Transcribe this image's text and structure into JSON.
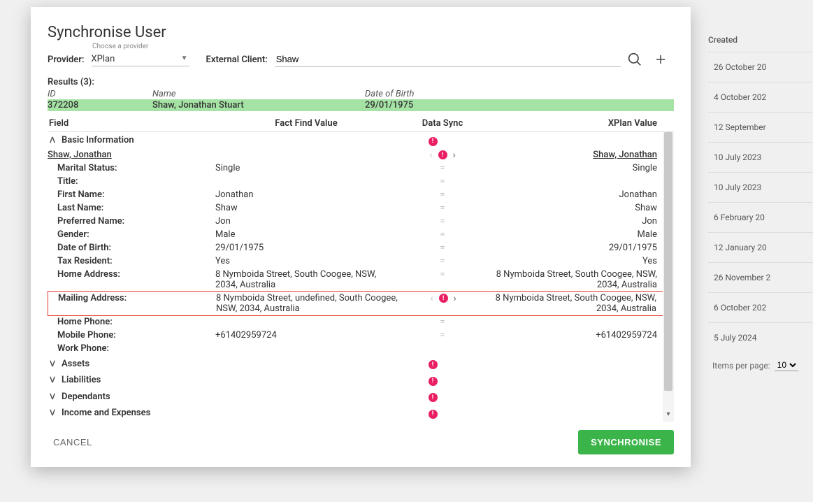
{
  "background": {
    "header": "Created",
    "rows": [
      "26 October 20",
      "4 October 202",
      "12 September",
      "10 July 2023",
      "10 July 2023",
      "6 February 20",
      "12 January 20",
      "26 November 2",
      "6 October 202",
      "5 July 2024"
    ],
    "items_per_page_label": "Items per page:",
    "items_per_page_value": "10"
  },
  "modal": {
    "title": "Synchronise User",
    "choose": "Choose a provider",
    "provider_label": "Provider:",
    "provider_value": "XPlan",
    "external_label": "External Client:",
    "external_value": "Shaw",
    "results_label": "Results (3):",
    "results_head": {
      "id": "ID",
      "name": "Name",
      "dob": "Date of Birth"
    },
    "result_row": {
      "id": "372208",
      "name": "Shaw, Jonathan Stuart",
      "dob": "29/01/1975"
    },
    "fields_head": {
      "field": "Field",
      "ff": "Fact Find Value",
      "sync": "Data Sync",
      "xplan": "XPlan Value"
    },
    "sections": {
      "basic": "Basic Information",
      "assets": "Assets",
      "liabilities": "Liabilities",
      "dependants": "Dependants",
      "income": "Income and Expenses"
    },
    "name_link_ff": "Shaw, Jonathan",
    "name_link_xp": "Shaw, Jonathan",
    "rows": {
      "marital": {
        "label": "Marital Status:",
        "ff": "Single",
        "xp": "Single"
      },
      "title": {
        "label": "Title:",
        "ff": "",
        "xp": ""
      },
      "first": {
        "label": "First Name:",
        "ff": "Jonathan",
        "xp": "Jonathan"
      },
      "last": {
        "label": "Last Name:",
        "ff": "Shaw",
        "xp": "Shaw"
      },
      "preferred": {
        "label": "Preferred Name:",
        "ff": "Jon",
        "xp": "Jon"
      },
      "gender": {
        "label": "Gender:",
        "ff": "Male",
        "xp": "Male"
      },
      "dob": {
        "label": "Date of Birth:",
        "ff": "29/01/1975",
        "xp": "29/01/1975"
      },
      "tax": {
        "label": "Tax Resident:",
        "ff": "Yes",
        "xp": "Yes"
      },
      "homeaddr": {
        "label": "Home Address:",
        "ff": "8 Nymboida Street, South Coogee, NSW, 2034, Australia",
        "xp": "8 Nymboida Street, South Coogee, NSW, 2034, Australia"
      },
      "mailaddr": {
        "label": "Mailing Address:",
        "ff": "8 Nymboida Street, undefined, South Coogee, NSW, 2034, Australia",
        "xp": "8 Nymboida Street, South Coogee, NSW, 2034, Australia"
      },
      "homephone": {
        "label": "Home Phone:",
        "ff": "",
        "xp": ""
      },
      "mobile": {
        "label": "Mobile Phone:",
        "ff": "+61402959724",
        "xp": "+61402959724"
      },
      "workphone": {
        "label": "Work Phone:",
        "ff": "",
        "xp": ""
      }
    },
    "cancel": "CANCEL",
    "synchronise": "SYNCHRONISE"
  }
}
